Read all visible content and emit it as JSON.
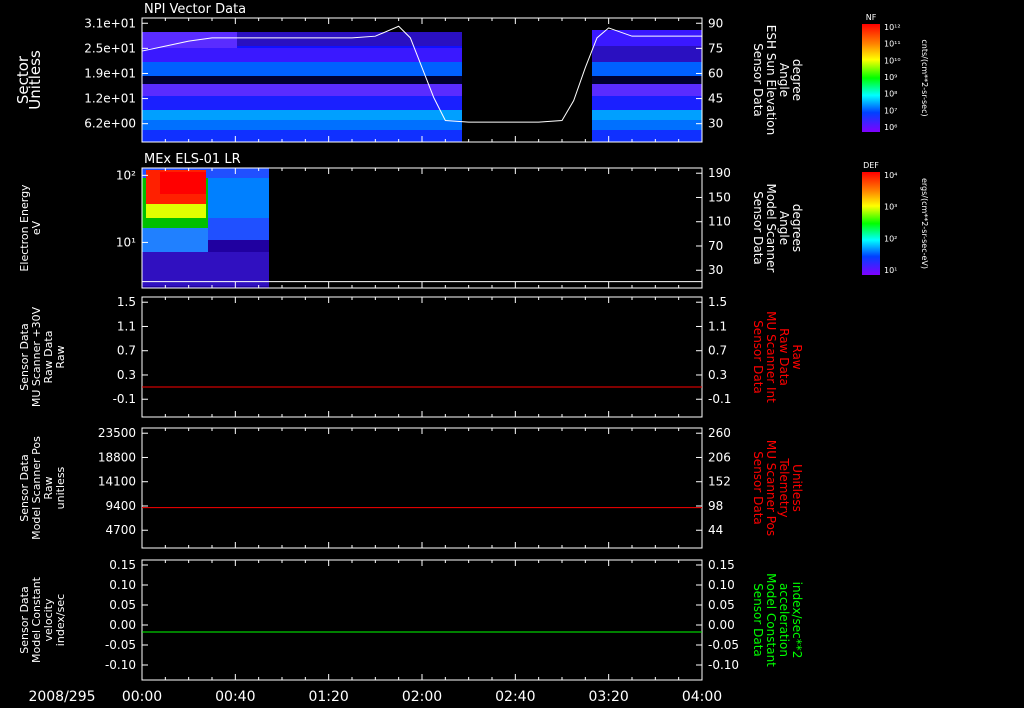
{
  "date_label": "2008/295",
  "time_ticks": [
    "00:00",
    "00:40",
    "01:20",
    "02:00",
    "02:40",
    "03:20",
    "04:00"
  ],
  "colors": {
    "axis": "#ffffff",
    "red": "#ff0000",
    "green": "#00ff00"
  },
  "chart_data": [
    {
      "type": "heatmap",
      "title": "NPI Vector Data",
      "ylabel_left": [
        "Sector",
        "Unitless"
      ],
      "ylabel_right": [
        "Sensor Data",
        "ESH Sun Elevation",
        "Angle",
        "degree"
      ],
      "yticks_left": [
        "3.1e+01",
        "2.5e+01",
        "1.9e+01",
        "1.2e+01",
        "6.2e+00"
      ],
      "yticks_right": [
        "90",
        "75",
        "60",
        "45",
        "30"
      ],
      "ylim_right": [
        15,
        90
      ],
      "line": {
        "x": [
          "00:00",
          "00:10",
          "00:20",
          "00:30",
          "00:40",
          "00:50",
          "01:00",
          "01:10",
          "01:20",
          "01:30",
          "01:40",
          "01:50",
          "01:55",
          "02:00",
          "02:05",
          "02:10",
          "02:20",
          "02:30",
          "02:40",
          "02:50",
          "03:00",
          "03:05",
          "03:10",
          "03:15",
          "03:20",
          "03:30",
          "03:40",
          "03:50",
          "04:00"
        ],
        "y": [
          70,
          73,
          76,
          78,
          78,
          78,
          78,
          78,
          78,
          78,
          79,
          85,
          78,
          60,
          42,
          28,
          27,
          27,
          27,
          27,
          28,
          40,
          60,
          78,
          84,
          79,
          79,
          79,
          79
        ]
      },
      "colorbar": {
        "label": "NF",
        "units": "cnts/(cm**2-sr-sec)",
        "ticks": [
          "10¹²",
          "10¹¹",
          "10¹⁰",
          "10⁹",
          "10⁸",
          "10⁷",
          "10⁶"
        ]
      }
    },
    {
      "type": "heatmap",
      "title": "MEx ELS-01 LR",
      "ylabel_left": [
        "Electron Energy",
        "eV"
      ],
      "ylabel_right": [
        "Sensor Data",
        "Model Scanner",
        "Angle",
        "degrees"
      ],
      "yticks_left": [
        "10²",
        "10¹"
      ],
      "yticks_right": [
        "190",
        "150",
        "110",
        "70",
        "30"
      ],
      "ylim_right": [
        0,
        190
      ],
      "line": {
        "x": [
          "00:00",
          "04:00"
        ],
        "y": [
          10,
          10
        ]
      },
      "colorbar": {
        "label": "DEF",
        "units": "ergs/(cm**2-sr-sec-eV)",
        "ticks": [
          "10⁴",
          "10³",
          "10²",
          "10¹"
        ]
      }
    },
    {
      "type": "line",
      "ylabel_left": [
        "Sensor Data",
        "MU Scanner +30V",
        "Raw Data",
        "Raw"
      ],
      "ylabel_right": [
        "Sensor Data",
        "MU Scanner Int",
        "Raw Data",
        "Raw"
      ],
      "yticks_left": [
        "1.5",
        "1.1",
        "0.7",
        "0.3",
        "-0.1"
      ],
      "yticks_right": [
        "1.5",
        "1.1",
        "0.7",
        "0.3",
        "-0.1"
      ],
      "ylim": [
        -0.5,
        1.5
      ],
      "series": [
        {
          "color": "#ff0000",
          "x": [
            "00:00",
            "04:00"
          ],
          "y": [
            0.0,
            0.0
          ]
        }
      ]
    },
    {
      "type": "line",
      "ylabel_left": [
        "Sensor Data",
        "Model Scanner Pos",
        "Raw",
        "unitless"
      ],
      "ylabel_right": [
        "Sensor Data",
        "MU Scanner Pos",
        "Telemetry",
        "Unitless"
      ],
      "yticks_left": [
        "23500",
        "18800",
        "14100",
        "9400",
        "4700"
      ],
      "yticks_right": [
        "260",
        "206",
        "152",
        "98",
        "44"
      ],
      "ylim": [
        0,
        23500
      ],
      "series": [
        {
          "color": "#ff0000",
          "x": [
            "00:00",
            "04:00"
          ],
          "y": [
            7900,
            7900
          ]
        }
      ]
    },
    {
      "type": "line",
      "ylabel_left": [
        "Sensor Data",
        "Model Constant",
        "velocity",
        "index/sec"
      ],
      "ylabel_right": [
        "Sensor Data",
        "Model Constant",
        "acceleration",
        "index/sec**2"
      ],
      "yticks_left": [
        "0.15",
        "0.10",
        "0.05",
        "0.00",
        "-0.05",
        "-0.10"
      ],
      "yticks_right": [
        "0.15",
        "0.10",
        "0.05",
        "0.00",
        "-0.05",
        "-0.10"
      ],
      "ylim": [
        -0.1,
        0.15
      ],
      "series": [
        {
          "color": "#00ff00",
          "x": [
            "00:00",
            "04:00"
          ],
          "y": [
            0.0,
            0.0
          ]
        }
      ]
    }
  ]
}
